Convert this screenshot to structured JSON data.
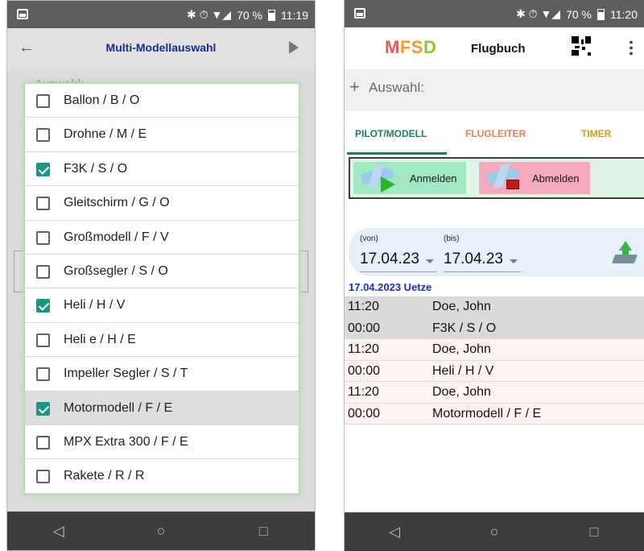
{
  "left_screen": {
    "status": {
      "icons": "✱ ⏱ ▼◢",
      "battery": "70 %",
      "time": "11:19"
    },
    "header": {
      "title": "Multi-Modellauswahl"
    },
    "bg_label": "Auswahl:",
    "options": [
      {
        "label": "Ballon / B / O",
        "checked": false
      },
      {
        "label": "Drohne / M / E",
        "checked": false
      },
      {
        "label": "F3K / S / O",
        "checked": true
      },
      {
        "label": "Gleitschirm / G / O",
        "checked": false
      },
      {
        "label": "Großmodell / F / V",
        "checked": false
      },
      {
        "label": "Großsegler / S / O",
        "checked": false
      },
      {
        "label": "Heli / H / V",
        "checked": true
      },
      {
        "label": "Heli e / H / E",
        "checked": false
      },
      {
        "label": "Impeller Segler / S / T",
        "checked": false
      },
      {
        "label": "Motormodell / F / E",
        "checked": true
      },
      {
        "label": "MPX Extra 300 / F / E",
        "checked": false
      },
      {
        "label": "Rakete / R / R",
        "checked": false
      }
    ],
    "highlighted_index": 9
  },
  "right_screen": {
    "status": {
      "icons": "✱ ⏱ ▼◢",
      "battery": "70 %",
      "time": "11:20"
    },
    "appbar": {
      "logo_m": "M",
      "logo_f": "F",
      "logo_s": "S",
      "logo_d": "D",
      "title": "Flugbuch"
    },
    "auswahl": {
      "plus": "+",
      "label": "Auswahl:"
    },
    "tabs": [
      "PILOT/MODELL",
      "FLUGLEITER",
      "TIMER"
    ],
    "buttons": {
      "anmelden": "Anmelden",
      "abmelden": "Abmelden"
    },
    "dates": {
      "from_label": "(von)",
      "from_value": "17.04.23",
      "to_label": "(bis)",
      "to_value": "17.04.23"
    },
    "log": {
      "title": "17.04.2023 Uetze",
      "rows": [
        {
          "col1": "11:20",
          "col2": "Doe, John"
        },
        {
          "col1": "00:00",
          "col2": "F3K / S / O"
        },
        {
          "col1": "11:20",
          "col2": "Doe, John"
        },
        {
          "col1": "00:00",
          "col2": "Heli / H / V"
        },
        {
          "col1": "11:20",
          "col2": "Doe, John"
        },
        {
          "col1": "00:00",
          "col2": "Motormodell / F / E"
        }
      ]
    }
  },
  "navbar": {
    "back": "◁",
    "home": "○",
    "recents": "□"
  },
  "colors": {
    "accent_teal": "#189686",
    "tab_green": "#1e7e5a",
    "tab_orange": "#ef7d4d",
    "tab_gold": "#d4a017",
    "log_title_blue": "#1d2bd1"
  }
}
